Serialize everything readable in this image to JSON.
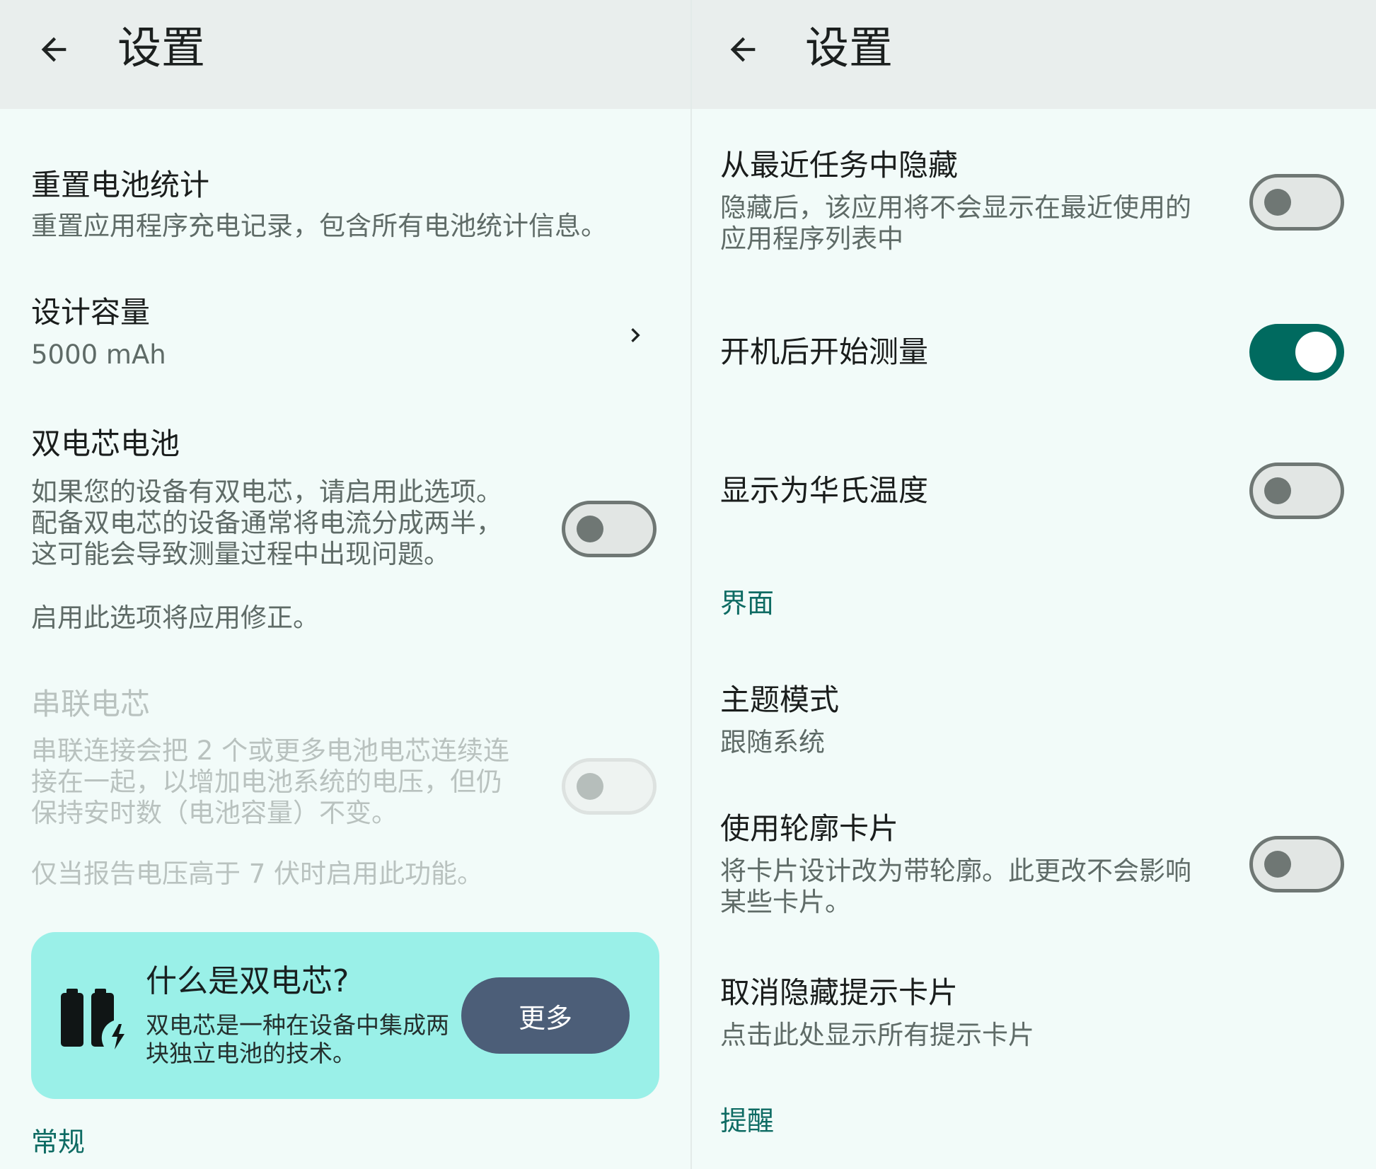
{
  "left": {
    "title": "设置",
    "reset_stats": {
      "title": "重置电池统计",
      "sub": "重置应用程序充电记录，包含所有电池统计信息。"
    },
    "design_capacity": {
      "title": "设计容量",
      "value": "5000 mAh"
    },
    "dual_cell": {
      "title": "双电芯电池",
      "sub": "如果您的设备有双电芯，请启用此选项。\n配备双电芯的设备通常将电流分成两半，\n这可能会导致测量过程中出现问题。",
      "note": "启用此选项将应用修正。",
      "on": false
    },
    "series_cell": {
      "title": "串联电芯",
      "sub": "串联连接会把 2 个或更多电池电芯连续连\n接在一起，以增加电池系统的电压，但仍\n保持安时数（电池容量）不变。",
      "note": "仅当报告电压高于 7 伏时启用此功能。",
      "on": false
    },
    "info_card": {
      "icon": "dual-battery-icon",
      "title": "什么是双电芯?",
      "text": "双电芯是一种在设备中集成两块独立电池的技术。",
      "button": "更多"
    },
    "section_general": "常规"
  },
  "right": {
    "title": "设置",
    "hide_recents": {
      "title": "从最近任务中隐藏",
      "sub": "隐藏后，该应用将不会显示在最近使用的\n应用程序列表中",
      "on": false
    },
    "measure_on_boot": {
      "title": "开机后开始测量",
      "on": true
    },
    "fahrenheit": {
      "title": "显示为华氏温度",
      "on": false
    },
    "section_interface": "界面",
    "theme_mode": {
      "title": "主题模式",
      "value": "跟随系统"
    },
    "outlined_cards": {
      "title": "使用轮廓卡片",
      "sub": "将卡片设计改为带轮廓。此更改不会影响\n某些卡片。",
      "on": false
    },
    "unhide_tips": {
      "title": "取消隐藏提示卡片",
      "sub": "点击此处显示所有提示卡片"
    },
    "section_reminder": "提醒"
  },
  "colors": {
    "accent": "#006a5f",
    "card": "#9af0e8",
    "button": "#4c5e78"
  }
}
